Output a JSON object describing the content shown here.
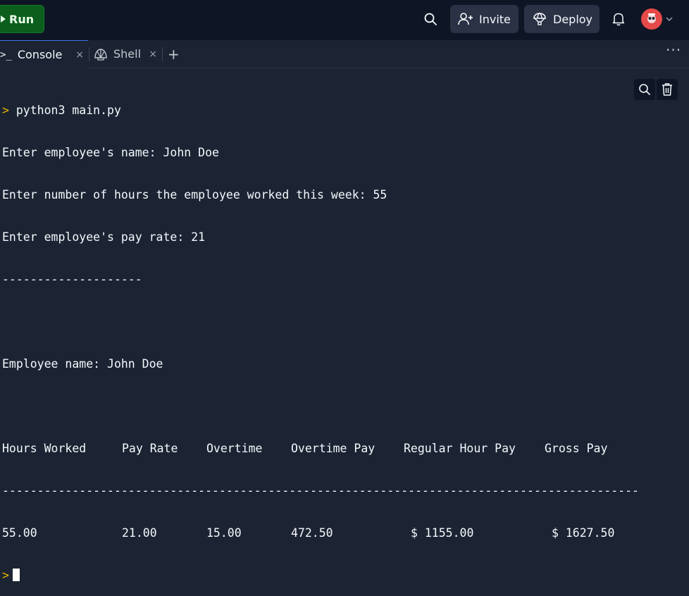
{
  "topbar": {
    "run_label": "Run",
    "invite_label": "Invite",
    "deploy_label": "Deploy"
  },
  "tabs": [
    {
      "glyph": ">_",
      "label": "Console",
      "close": "×"
    },
    {
      "label": "Shell",
      "close": "×"
    }
  ],
  "tab_add": "+",
  "tab_more": "···",
  "console": {
    "prompt_symbol": ">",
    "command": "python3 main.py",
    "lines": [
      "Enter employee's name: John Doe",
      "Enter number of hours the employee worked this week: 55",
      "Enter employee's pay rate: 21",
      "--------------------",
      "",
      "Employee name: John Doe",
      ""
    ],
    "table_headers": [
      "Hours Worked",
      "Pay Rate",
      "Overtime",
      "Overtime Pay",
      "Regular Hour Pay",
      "Gross Pay"
    ],
    "table_divider": "-------------------------------------------------------------------------------------------",
    "table_row": [
      "55.00",
      "21.00",
      "15.00",
      "472.50",
      "$ 1155.00",
      "$ 1627.50"
    ]
  },
  "colors": {
    "background": "#1c2333",
    "topbar": "#0e1525",
    "run_button": "#0b5e1c",
    "prompt": "#e6b800",
    "avatar": "#e64949"
  },
  "icons": [
    "play-icon",
    "search-icon",
    "add-user-icon",
    "deploy-icon",
    "bell-icon",
    "avatar",
    "chevron-down-icon",
    "terminal-icon",
    "shell-icon",
    "close-icon",
    "plus-icon",
    "more-icon",
    "trash-icon"
  ]
}
